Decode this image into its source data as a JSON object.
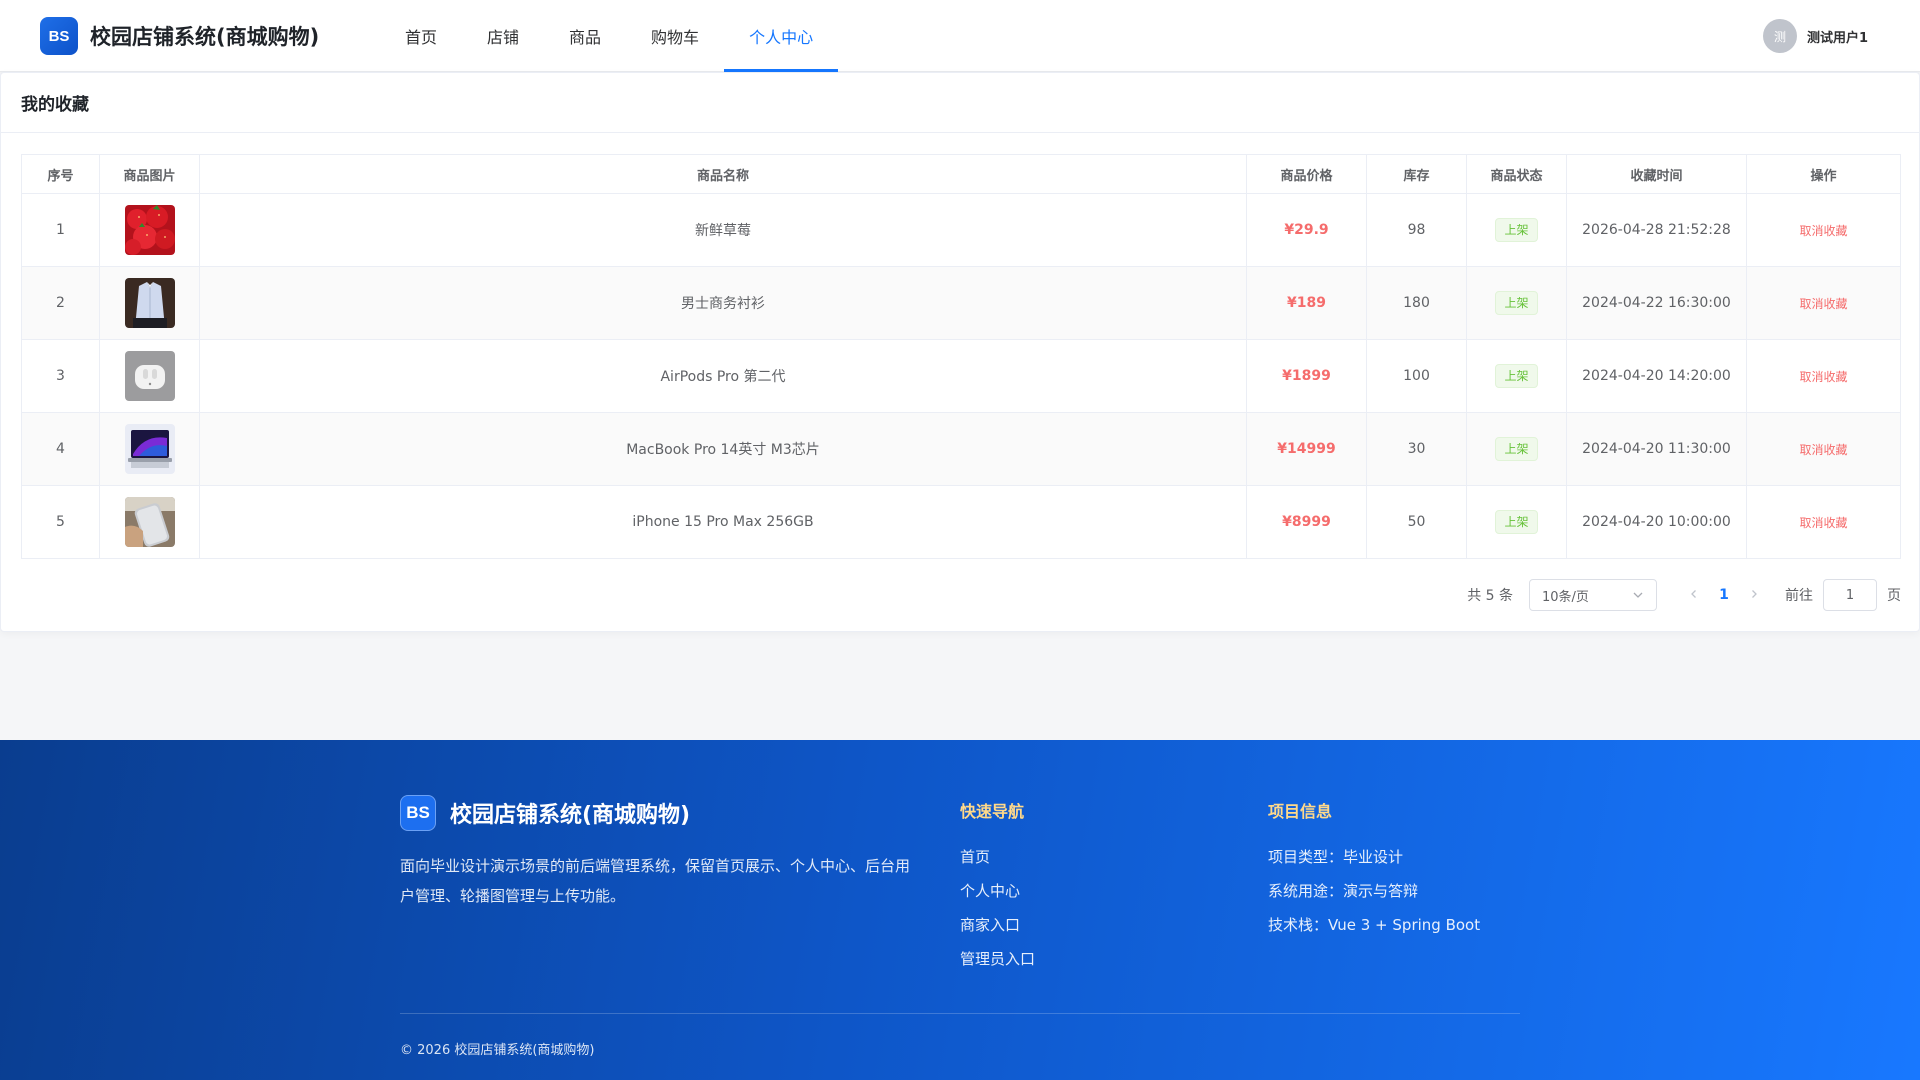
{
  "header": {
    "logo_badge": "BS",
    "title": "校园店铺系统(商城购物)",
    "nav": [
      {
        "label": "首页"
      },
      {
        "label": "店铺"
      },
      {
        "label": "商品"
      },
      {
        "label": "购物车"
      },
      {
        "label": "个人中心"
      }
    ],
    "active_nav": "个人中心",
    "user": {
      "avatar_text": "测",
      "name": "测试用户1"
    }
  },
  "favorites": {
    "title": "我的收藏",
    "columns": [
      "序号",
      "商品图片",
      "商品名称",
      "商品价格",
      "库存",
      "商品状态",
      "收藏时间",
      "操作"
    ],
    "rows": [
      {
        "index": "1",
        "image": "strawberry-image",
        "name": "新鲜草莓",
        "price": "¥29.9",
        "stock": "98",
        "status": "上架",
        "time": "2026-04-28 21:52:28",
        "action": "取消收藏"
      },
      {
        "index": "2",
        "image": "shirt-image",
        "name": "男士商务衬衫",
        "price": "¥189",
        "stock": "180",
        "status": "上架",
        "time": "2024-04-22 16:30:00",
        "action": "取消收藏"
      },
      {
        "index": "3",
        "image": "airpods-image",
        "name": "AirPods Pro 第二代",
        "price": "¥1899",
        "stock": "100",
        "status": "上架",
        "time": "2024-04-20 14:20:00",
        "action": "取消收藏"
      },
      {
        "index": "4",
        "image": "macbook-image",
        "name": "MacBook Pro 14英寸 M3芯片",
        "price": "¥14999",
        "stock": "30",
        "status": "上架",
        "time": "2024-04-20 11:30:00",
        "action": "取消收藏"
      },
      {
        "index": "5",
        "image": "iphone-image",
        "name": "iPhone 15 Pro Max 256GB",
        "price": "¥8999",
        "stock": "50",
        "status": "上架",
        "time": "2024-04-20 10:00:00",
        "action": "取消收藏"
      }
    ],
    "pagination": {
      "total": "共 5 条",
      "page_size": "10条/页",
      "current_page": "1",
      "goto_label": "前往",
      "goto_value": "1",
      "page_suffix": "页"
    }
  },
  "footer": {
    "logo_badge": "BS",
    "title": "校园店铺系统(商城购物)",
    "description": "面向毕业设计演示场景的前后端管理系统，保留首页展示、个人中心、后台用户管理、轮播图管理与上传功能。",
    "quick_nav": {
      "title": "快速导航",
      "links": [
        "首页",
        "个人中心",
        "商家入口",
        "管理员入口"
      ]
    },
    "project_info": {
      "title": "项目信息",
      "items": [
        "项目类型：毕业设计",
        "系统用途：演示与答辩",
        "技术栈：Vue 3 + Spring Boot"
      ]
    },
    "copyright": "© 2026 校园店铺系统(商城购物)"
  },
  "colors": {
    "accent": "#1677ff",
    "price": "#f56c6c",
    "status_tag": "#67c23a",
    "footer_gradient_start": "#0a3d8f",
    "footer_gradient_end": "#1878ff",
    "footer_heading": "#ffd98a"
  }
}
